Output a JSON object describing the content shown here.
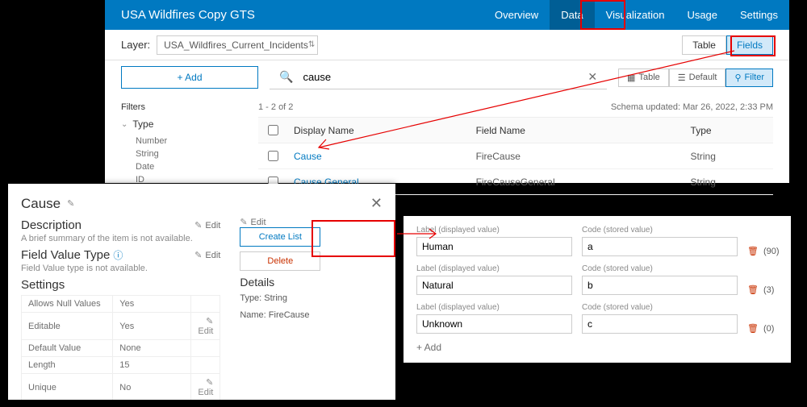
{
  "ribbon": {
    "title": "USA Wildfires Copy GTS",
    "tabs": [
      "Overview",
      "Data",
      "Visualization",
      "Usage",
      "Settings"
    ],
    "active": 1
  },
  "layerbar": {
    "label": "Layer:",
    "selected": "USA_Wildfires_Current_Incidents",
    "btn_table": "Table",
    "btn_fields": "Fields"
  },
  "toolrow": {
    "add": "+   Add",
    "search_value": "cause",
    "view_table": "Table",
    "view_default": "Default",
    "view_filter": "Filter"
  },
  "filters": {
    "heading": "Filters",
    "group": "Type",
    "items": [
      "Number",
      "String",
      "Date",
      "ID"
    ]
  },
  "meta": {
    "count": "1 - 2 of 2",
    "schema": "Schema updated: Mar 26, 2022, 2:33 PM"
  },
  "cols": {
    "c1": "Display Name",
    "c2": "Field Name",
    "c3": "Type"
  },
  "rows": [
    {
      "dn": "Cause",
      "fn": "FireCause",
      "t": "String"
    },
    {
      "dn": "Cause General",
      "fn": "FireCauseGeneral",
      "t": "String"
    }
  ],
  "modal": {
    "title": "Cause",
    "desc_h": "Description",
    "desc_t": "A brief summary of the item is not available.",
    "fvt_h": "Field Value Type",
    "fvt_t": "Field Value type is not available.",
    "set_h": "Settings",
    "edit": "Edit",
    "create": "Create List",
    "delete": "Delete",
    "details_h": "Details",
    "d_type": "Type: String",
    "d_name": "Name: FireCause",
    "settings": [
      {
        "k": "Allows Null Values",
        "v": "Yes",
        "e": ""
      },
      {
        "k": "Editable",
        "v": "Yes",
        "e": "Edit"
      },
      {
        "k": "Default Value",
        "v": "None",
        "e": ""
      },
      {
        "k": "Length",
        "v": "15",
        "e": ""
      },
      {
        "k": "Unique",
        "v": "No",
        "e": "Edit"
      }
    ]
  },
  "list": {
    "lab_label": "Label (displayed value)",
    "lab_code": "Code (stored value)",
    "rows": [
      {
        "label": "Human",
        "code": "a",
        "count": "(90)"
      },
      {
        "label": "Natural",
        "code": "b",
        "count": "(3)"
      },
      {
        "label": "Unknown",
        "code": "c",
        "count": "(0)"
      }
    ],
    "add": "+  Add"
  }
}
